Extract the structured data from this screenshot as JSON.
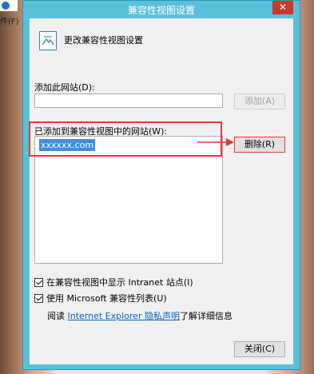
{
  "window": {
    "title": "兼容性视图设置",
    "close_glyph": "✕"
  },
  "header": {
    "text": "更改兼容性视图设置",
    "icon": "compatibility-icon"
  },
  "add_site": {
    "label": "添加此网站(D):",
    "value": "",
    "button_label": "添加(A)"
  },
  "site_list": {
    "label": "已添加到兼容性视图中的网站(W):",
    "items": [
      "xxxxxx.com"
    ],
    "delete_label": "删除(R)"
  },
  "options": {
    "intranet_label": "在兼容性视图中显示 Intranet 站点(I)",
    "intranet_checked": true,
    "ms_list_label": "使用 Microsoft 兼容性列表(U)",
    "ms_list_checked": true
  },
  "privacy": {
    "prefix": "阅读",
    "link_text": "Internet Explorer 隐私声明",
    "suffix": "了解详细信息"
  },
  "footer": {
    "close_label": "关闭(C)"
  },
  "annotations": {
    "highlight_color": "#e23a3a"
  },
  "background": {
    "edge_text": "件(F)"
  }
}
